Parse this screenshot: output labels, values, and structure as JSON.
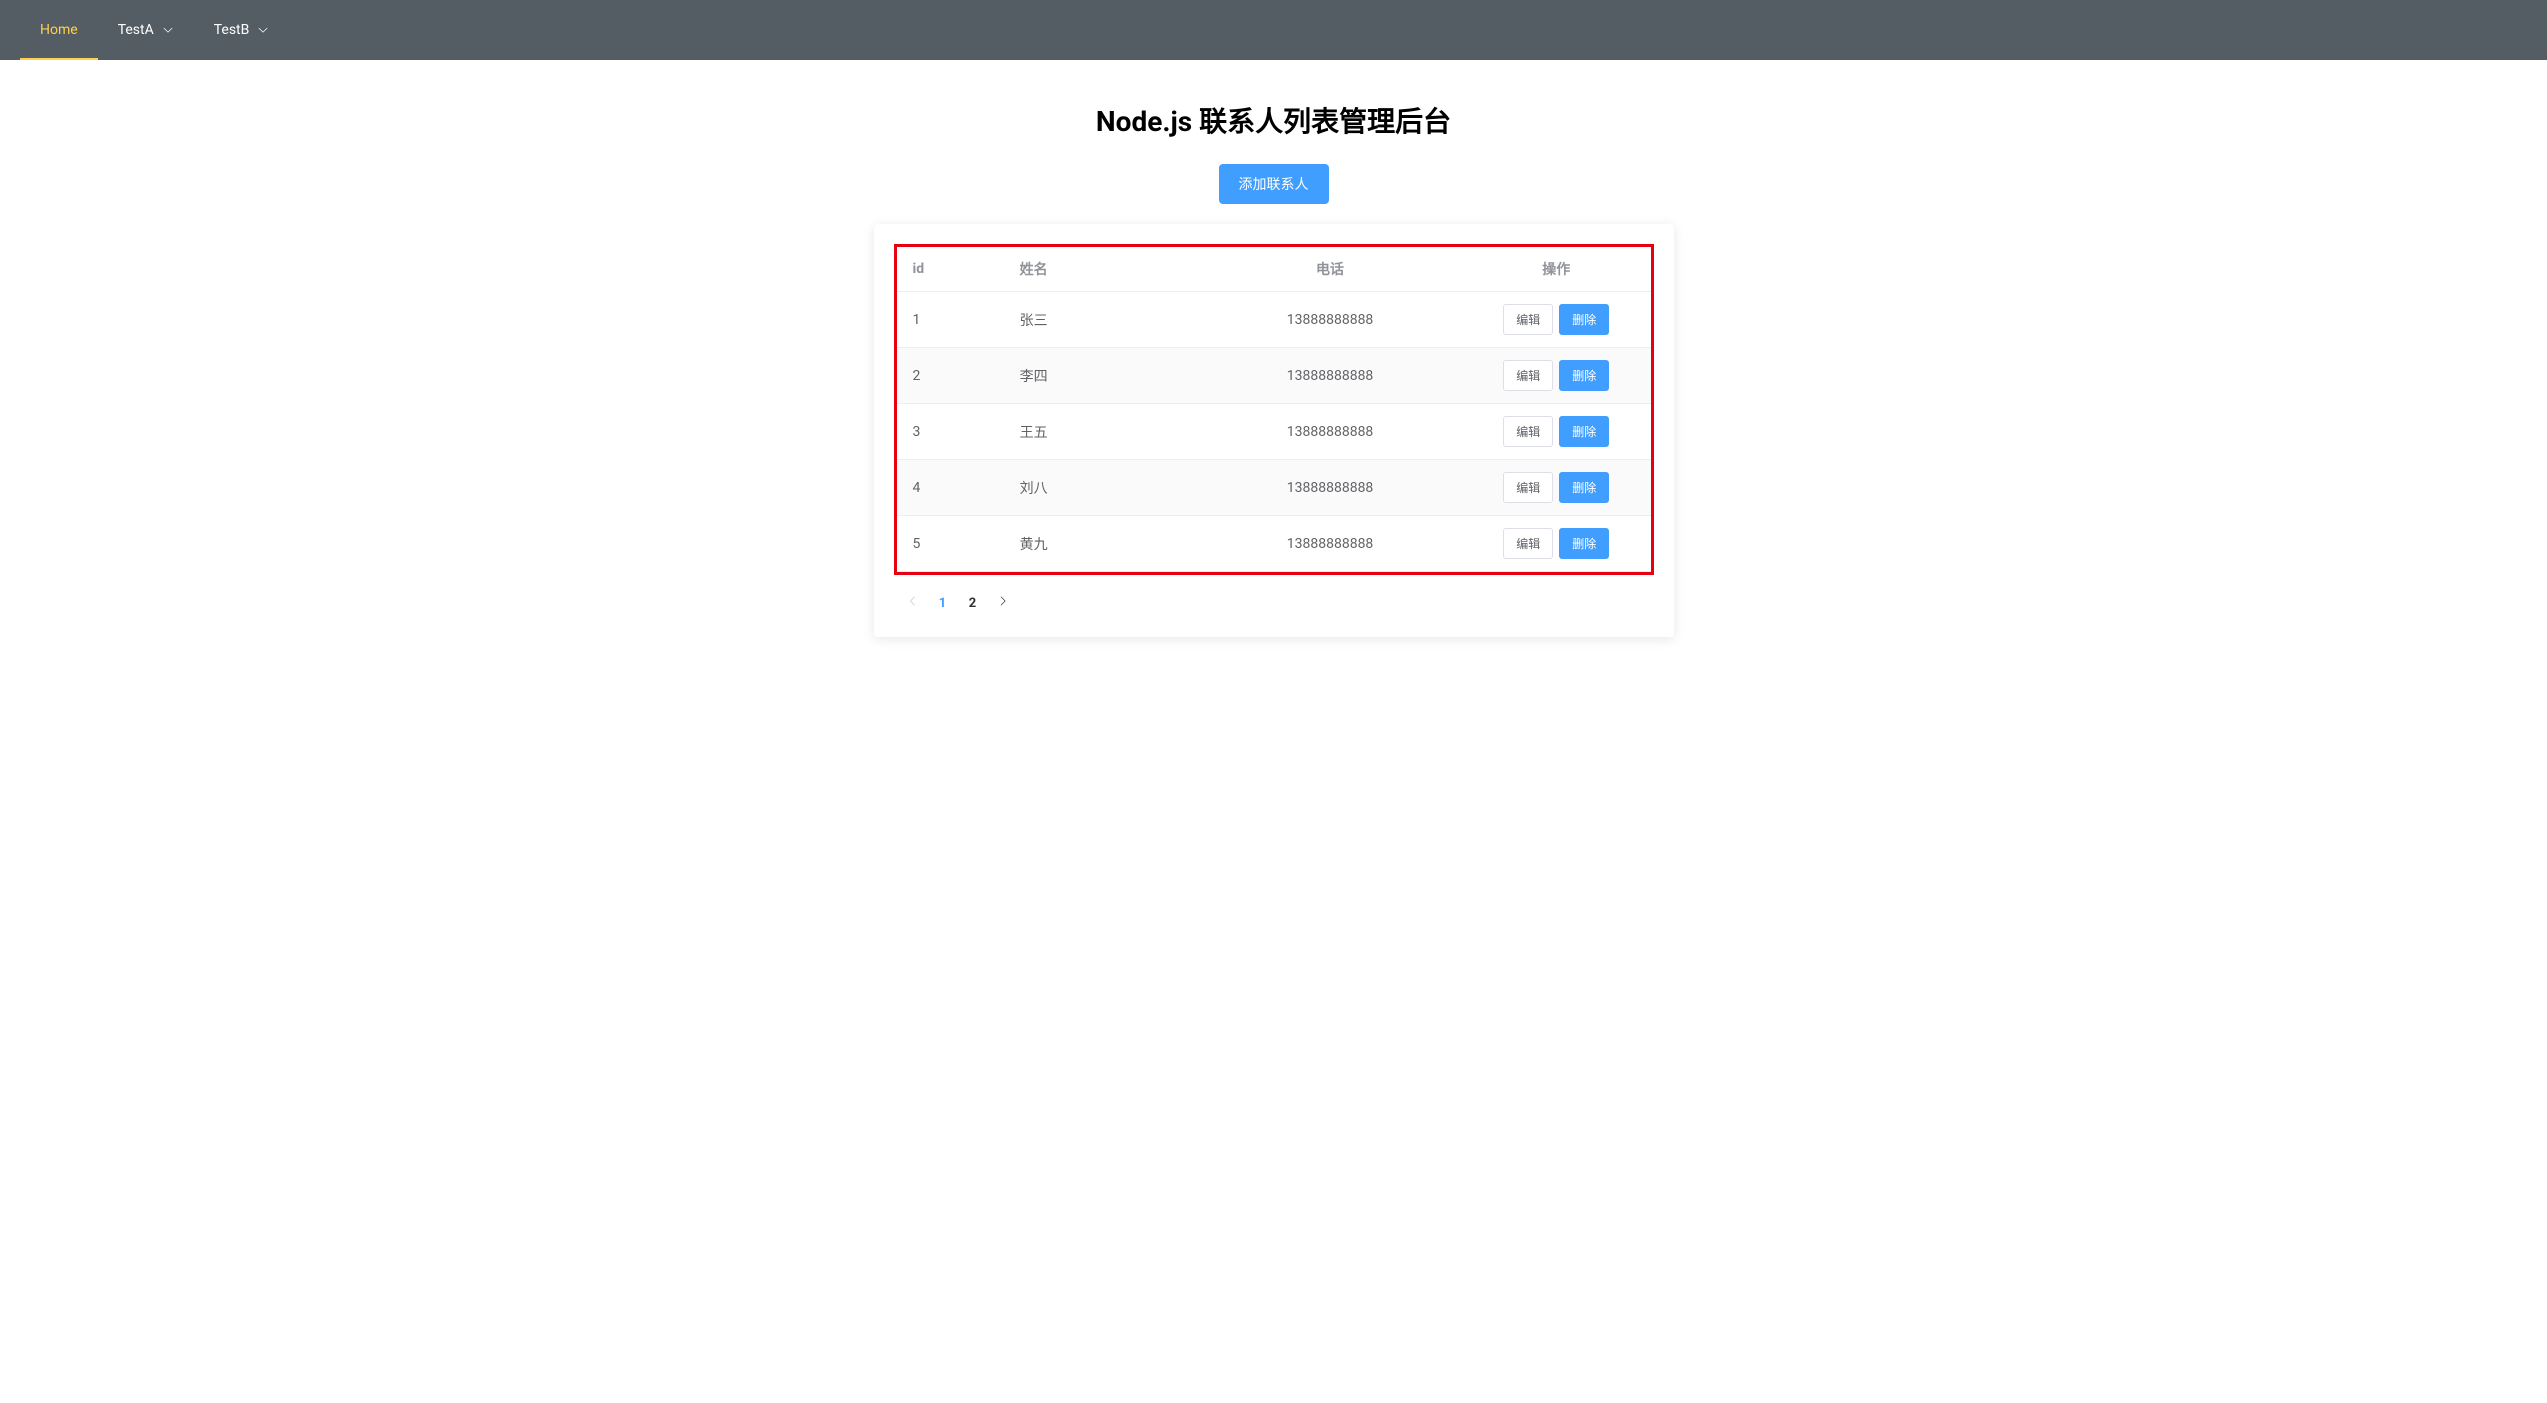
{
  "nav": {
    "items": [
      {
        "label": "Home",
        "hasDropdown": false,
        "active": true
      },
      {
        "label": "TestA",
        "hasDropdown": true,
        "active": false
      },
      {
        "label": "TestB",
        "hasDropdown": true,
        "active": false
      }
    ]
  },
  "header": {
    "title": "Node.js 联系人列表管理后台",
    "addButton": "添加联系人"
  },
  "table": {
    "columns": {
      "id": "id",
      "name": "姓名",
      "phone": "电话",
      "action": "操作"
    },
    "actions": {
      "edit": "编辑",
      "delete": "删除"
    },
    "rows": [
      {
        "id": "1",
        "name": "张三",
        "phone": "13888888888"
      },
      {
        "id": "2",
        "name": "李四",
        "phone": "13888888888"
      },
      {
        "id": "3",
        "name": "王五",
        "phone": "13888888888"
      },
      {
        "id": "4",
        "name": "刘八",
        "phone": "13888888888"
      },
      {
        "id": "5",
        "name": "黄九",
        "phone": "13888888888"
      }
    ]
  },
  "pagination": {
    "pages": [
      "1",
      "2"
    ],
    "current": 1
  }
}
